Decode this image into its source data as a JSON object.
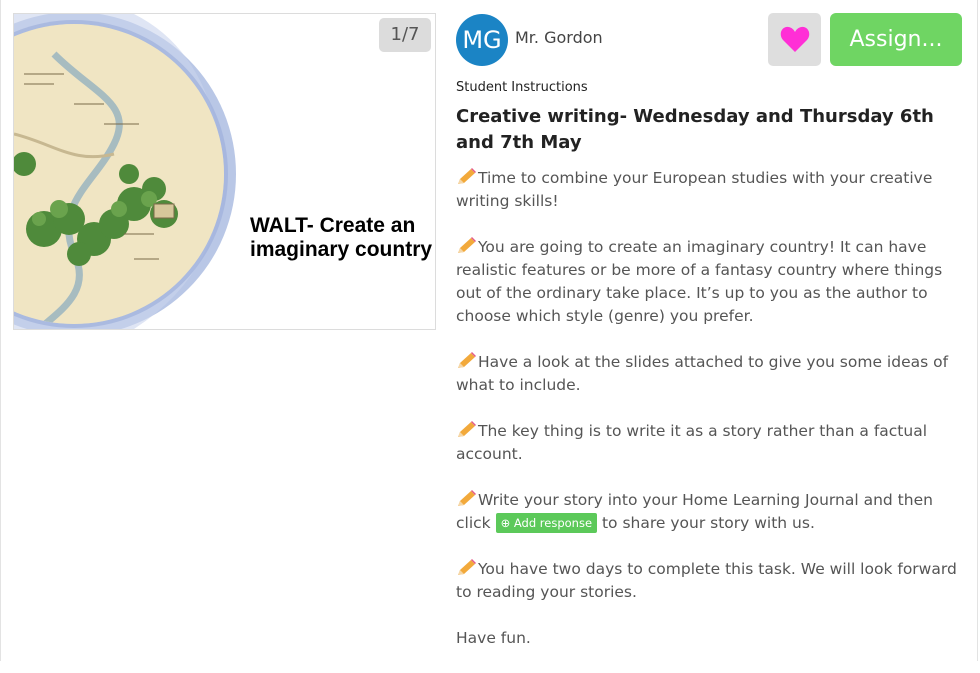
{
  "slide": {
    "counter": "1/7",
    "title": "WALT- Create an\nimaginary country"
  },
  "header": {
    "avatar_initials": "MG",
    "teacher_name": "Mr. Gordon",
    "assign_label": "Assign..."
  },
  "colors": {
    "avatar": "#1b84c5",
    "assign": "#6fd563",
    "heart": "#ff2fd6",
    "add_response": "#5cc95a"
  },
  "content": {
    "section_label": "Student Instructions",
    "title": "Creative writing- Wednesday and Thursday 6th and 7th May",
    "p1": "Time to combine your European studies with your creative writing skills!",
    "p2": "You are going to create an imaginary country! It can have realistic features or be more of a fantasy country where things out of the ordinary take place. It’s up to you as the author to choose which style (genre) you prefer.",
    "p3": "Have a look at the slides attached to give you some ideas of what to include.",
    "p4": "The key thing is to write it as a story rather than a factual account.",
    "p5_a": "Write your story into your Home Learning Journal and then click",
    "add_response": "Add response",
    "p5_b": "to share your story with us.",
    "p6": "You have two days to complete this task. We will look forward to reading your stories.",
    "p7": "Have fun."
  }
}
